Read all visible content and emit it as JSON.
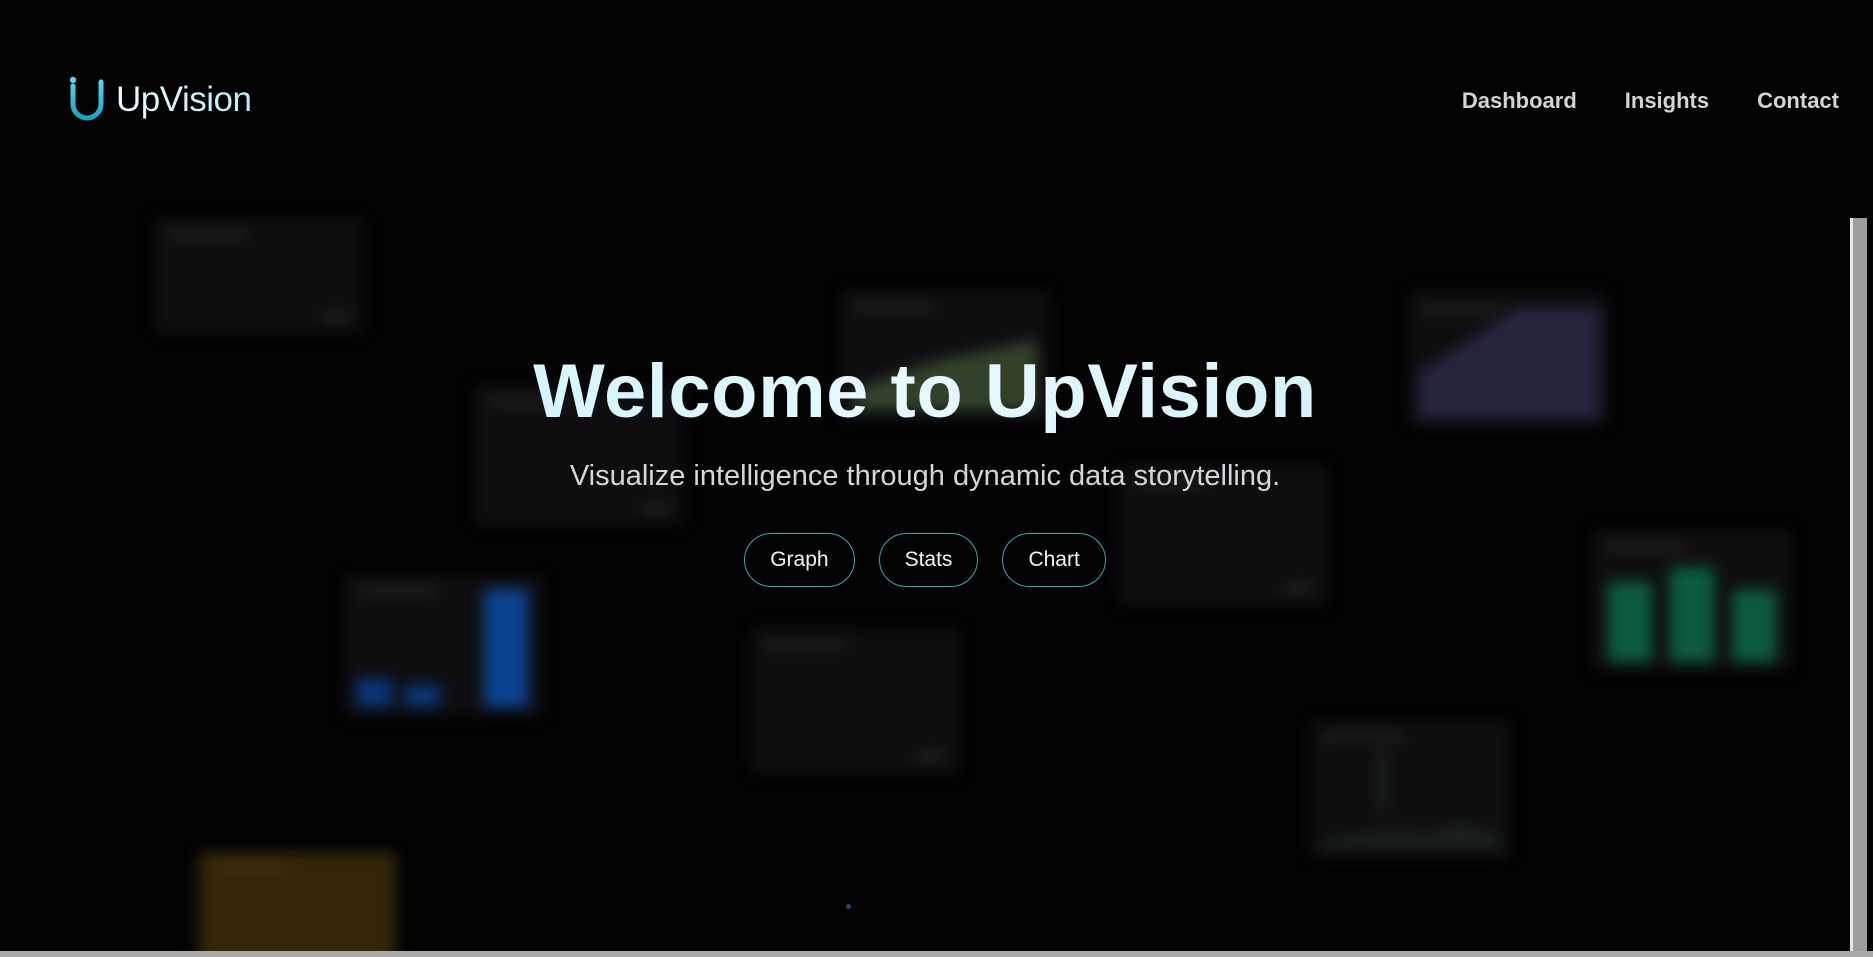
{
  "header": {
    "brand": "UpVision",
    "logo_icon": "u-logo-icon",
    "nav": [
      {
        "label": "Dashboard"
      },
      {
        "label": "Insights"
      },
      {
        "label": "Contact"
      }
    ]
  },
  "hero": {
    "title": "Welcome to UpVision",
    "subtitle": "Visualize intelligence through dynamic data storytelling.",
    "buttons": [
      {
        "label": "Graph"
      },
      {
        "label": "Stats"
      },
      {
        "label": "Chart"
      }
    ]
  },
  "colors": {
    "background": "#020203",
    "accent": "#3aa6b4",
    "title_gradient_start": "#bff0fa",
    "title_gradient_end": "#c4eaf5"
  }
}
